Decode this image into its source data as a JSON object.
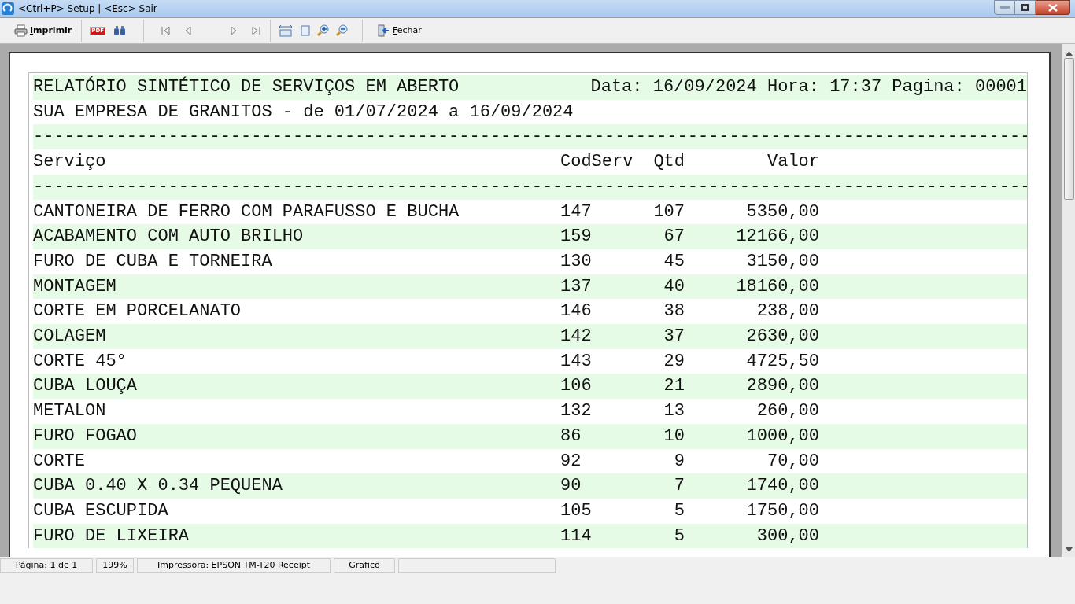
{
  "window": {
    "title": "<Ctrl+P> Setup | <Esc> Sair"
  },
  "toolbar": {
    "print_label": "Imprimir",
    "pdf_label": "PDF",
    "close_label": "Fechar"
  },
  "report": {
    "title": "RELATÓRIO SINTÉTICO DE SERVIÇOS EM ABERTO",
    "header_info": "Data: 16/09/2024 Hora: 17:37 Pagina: 00001",
    "subtitle": "SUA EMPRESA DE GRANITOS - de 01/07/2024 a 16/09/2024",
    "separator": "------------------------------------------------------------------------------------------------",
    "columns": [
      "Serviço",
      "CodServ",
      "Qtd",
      "Valor"
    ],
    "rows": [
      {
        "servico": "CANTONEIRA DE FERRO COM PARAFUSSO E BUCHA",
        "cod": "147",
        "qtd": "107",
        "valor": "5350,00"
      },
      {
        "servico": "ACABAMENTO COM AUTO BRILHO",
        "cod": "159",
        "qtd": "67",
        "valor": "12166,00"
      },
      {
        "servico": "FURO DE CUBA E TORNEIRA",
        "cod": "130",
        "qtd": "45",
        "valor": "3150,00"
      },
      {
        "servico": "MONTAGEM",
        "cod": "137",
        "qtd": "40",
        "valor": "18160,00"
      },
      {
        "servico": "CORTE EM PORCELANATO",
        "cod": "146",
        "qtd": "38",
        "valor": "238,00"
      },
      {
        "servico": "COLAGEM",
        "cod": "142",
        "qtd": "37",
        "valor": "2630,00"
      },
      {
        "servico": "CORTE 45°",
        "cod": "143",
        "qtd": "29",
        "valor": "4725,50"
      },
      {
        "servico": "CUBA LOUÇA",
        "cod": "106",
        "qtd": "21",
        "valor": "2890,00"
      },
      {
        "servico": "METALON",
        "cod": "132",
        "qtd": "13",
        "valor": "260,00"
      },
      {
        "servico": "FURO FOGAO",
        "cod": "86",
        "qtd": "10",
        "valor": "1000,00"
      },
      {
        "servico": "CORTE",
        "cod": "92",
        "qtd": "9",
        "valor": "70,00"
      },
      {
        "servico": "CUBA 0.40 X 0.34 PEQUENA",
        "cod": "90",
        "qtd": "7",
        "valor": "1740,00"
      },
      {
        "servico": "CUBA ESCUPIDA",
        "cod": "105",
        "qtd": "5",
        "valor": "1750,00"
      },
      {
        "servico": "FURO DE LIXEIRA",
        "cod": "114",
        "qtd": "5",
        "valor": "300,00"
      }
    ]
  },
  "status_bar": [
    "Página: 1 de 1",
    "199%",
    "Impressora: EPSON TM-T20 Receipt",
    "Grafico"
  ]
}
